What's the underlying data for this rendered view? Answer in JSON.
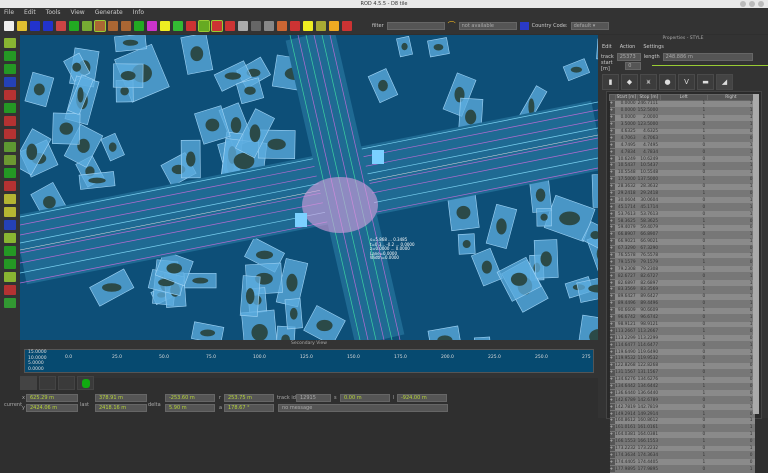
{
  "window": {
    "title": "ROD 4.5.5 - D8 tile"
  },
  "menu": [
    "File",
    "Edit",
    "Tools",
    "View",
    "Generate",
    "Info"
  ],
  "toolbar": {
    "filter_label": "filter",
    "filter_value": "",
    "gps_value": "not available",
    "country_label": "Country Code:",
    "country_value": "default"
  },
  "secondary_view": {
    "title": "Secondary View",
    "y_ticks": [
      "15.0000",
      "10.0000",
      "5.0000",
      "0.0000"
    ],
    "x_ticks": [
      "0.0",
      "25.0",
      "50.0",
      "75.0",
      "100.0",
      "125.0",
      "150.0",
      "175.0",
      "200.0",
      "225.0",
      "250.0",
      "275"
    ]
  },
  "map_label": [
    "s=5.868 ... 0.3485",
    "t=0.3...  -0.2 ... 0.0000",
    "z=0.0000 ... 0.0000",
    "Lane=0.0000",
    "Width=0.0000"
  ],
  "status": {
    "current_label": "current",
    "last_label": "last",
    "delta_label": "delta",
    "x": "x",
    "y": "y",
    "r": "r",
    "a": "a",
    "s": "s",
    "l": "l",
    "current_x": "625.29 m",
    "current_y": "2424.06 m",
    "last_x": "378.91 m",
    "last_y": "2418.16 m",
    "delta_x": "-253.60 m",
    "delta_y": "5.90 m",
    "r_value": "253.75 m",
    "a_value": "178.67 °",
    "track_id_label": "track id",
    "track_id": "12915",
    "s_value": "0.00 m",
    "l_value": "-924.00 m",
    "message": "no message"
  },
  "properties": {
    "title": "Properties - STYLE",
    "menu": [
      "Edit",
      "Action",
      "Settings"
    ],
    "track_label": "track",
    "track_value": "25373",
    "length_label": "length",
    "length_value": "248.886 m",
    "start_label": "start [m]",
    "start_value": "0",
    "columns": [
      "Start [m]",
      "Stop [m]",
      "Left",
      "Right"
    ],
    "rows": [
      [
        "0.0000",
        "246.7111",
        "1",
        "1"
      ],
      [
        "0.0000",
        "152.5000",
        "1",
        "1"
      ],
      [
        "0.0000",
        "2.0000",
        "1",
        "1"
      ],
      [
        "3.5000",
        "123.5000",
        "0",
        "1"
      ],
      [
        "4.6325",
        "4.6325",
        "1",
        "0"
      ],
      [
        "4.7063",
        "4.7063",
        "1",
        "0"
      ],
      [
        "4.7495",
        "4.7495",
        "0",
        "1"
      ],
      [
        "4.7834",
        "4.7834",
        "0",
        "1"
      ],
      [
        "10.6249",
        "10.6249",
        "0",
        "1"
      ],
      [
        "10.5437",
        "10.5437",
        "0",
        "1"
      ],
      [
        "10.5548",
        "10.5548",
        "0",
        "1"
      ],
      [
        "17.5000",
        "137.5000",
        "1",
        "0"
      ],
      [
        "28.3632",
        "28.3632",
        "0",
        "1"
      ],
      [
        "29.2418",
        "29.2418",
        "1",
        "0"
      ],
      [
        "30.0604",
        "30.0604",
        "0",
        "1"
      ],
      [
        "45.1714",
        "45.1714",
        "0",
        "1"
      ],
      [
        "53.7613",
        "53.7613",
        "0",
        "1"
      ],
      [
        "58.3625",
        "58.3625",
        "1",
        "0"
      ],
      [
        "59.4079",
        "59.4079",
        "1",
        "0"
      ],
      [
        "66.8907",
        "66.8907",
        "0",
        "1"
      ],
      [
        "66.9021",
        "66.9021",
        "0",
        "1"
      ],
      [
        "67.3290",
        "67.3290",
        "1",
        "0"
      ],
      [
        "76.5578",
        "76.5578",
        "0",
        "1"
      ],
      [
        "79.1579",
        "79.1579",
        "1",
        "0"
      ],
      [
        "79.2308",
        "79.2308",
        "1",
        "0"
      ],
      [
        "82.6727",
        "82.6727",
        "0",
        "1"
      ],
      [
        "82.6897",
        "82.6897",
        "0",
        "1"
      ],
      [
        "83.3569",
        "83.3569",
        "1",
        "0"
      ],
      [
        "89.6427",
        "89.6427",
        "0",
        "1"
      ],
      [
        "89.4496",
        "89.4496",
        "0",
        "1"
      ],
      [
        "90.6609",
        "90.6609",
        "1",
        "0"
      ],
      [
        "96.6742",
        "96.6742",
        "0",
        "1"
      ],
      [
        "98.9121",
        "98.9121",
        "0",
        "1"
      ],
      [
        "113.2667",
        "113.2667",
        "1",
        "0"
      ],
      [
        "113.2299",
        "113.2299",
        "1",
        "0"
      ],
      [
        "114.6477",
        "114.6477",
        "0",
        "1"
      ],
      [
        "119.6490",
        "119.6490",
        "0",
        "1"
      ],
      [
        "119.9532",
        "119.9532",
        "0",
        "1"
      ],
      [
        "122.8268",
        "122.8268",
        "1",
        "0"
      ],
      [
        "131.1567",
        "131.1567",
        "0",
        "1"
      ],
      [
        "134.6276",
        "134.6276",
        "1",
        "0"
      ],
      [
        "134.6442",
        "134.6442",
        "1",
        "0"
      ],
      [
        "136.6440",
        "136.6440",
        "1",
        "0"
      ],
      [
        "142.6789",
        "142.6789",
        "0",
        "1"
      ],
      [
        "142.7819",
        "142.7819",
        "0",
        "1"
      ],
      [
        "149.2914",
        "149.2914",
        "1",
        "0"
      ],
      [
        "160.8612",
        "160.8612",
        "0",
        "1"
      ],
      [
        "161.0161",
        "161.0161",
        "0",
        "1"
      ],
      [
        "164.0381",
        "164.0381",
        "0",
        "1"
      ],
      [
        "166.1553",
        "166.1553",
        "1",
        "0"
      ],
      [
        "173.2232",
        "173.2232",
        "0",
        "1"
      ],
      [
        "174.3634",
        "174.3634",
        "1",
        "0"
      ],
      [
        "174.4405",
        "174.4405",
        "1",
        "0"
      ],
      [
        "177.9895",
        "177.9895",
        "0",
        "1"
      ]
    ]
  },
  "colors": {
    "map_bg": "#0d4f78",
    "building": "#5eaee0",
    "road": "#b36bd1",
    "accent": "#b6d43a"
  }
}
